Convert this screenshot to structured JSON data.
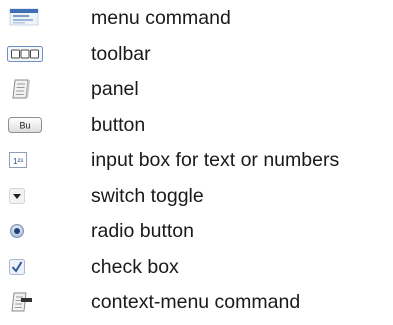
{
  "legend": {
    "items": [
      {
        "icon": "menu-command-icon",
        "label": "menu command"
      },
      {
        "icon": "toolbar-icon",
        "label": "toolbar"
      },
      {
        "icon": "panel-icon",
        "label": "panel"
      },
      {
        "icon": "button-icon",
        "icon_text": "Bu",
        "label": "button"
      },
      {
        "icon": "input-box-icon",
        "icon_text": "1²³",
        "label": "input box for text or numbers"
      },
      {
        "icon": "switch-toggle-icon",
        "label": "switch toggle"
      },
      {
        "icon": "radio-button-icon",
        "label": "radio button"
      },
      {
        "icon": "check-box-icon",
        "label": "check box"
      },
      {
        "icon": "context-menu-command-icon",
        "label": "context-menu command"
      }
    ]
  }
}
